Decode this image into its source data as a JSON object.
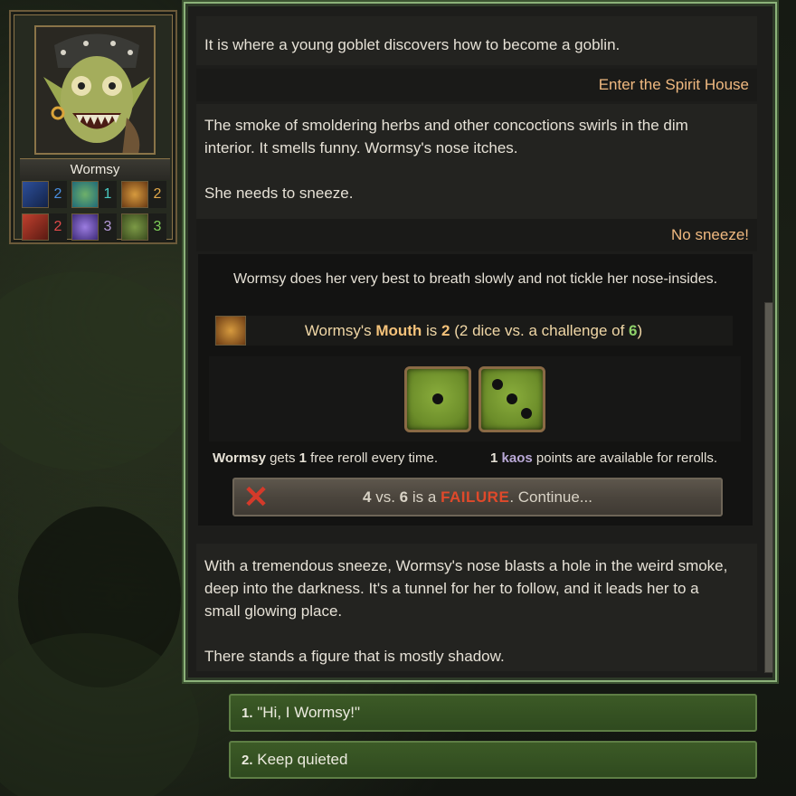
{
  "character": {
    "name": "Wormsy",
    "stats": [
      {
        "icon": "hood-goblin-icon",
        "value": "2",
        "color": "#4a8ee0"
      },
      {
        "icon": "goblin-face-icon",
        "value": "1",
        "color": "#48c9c2"
      },
      {
        "icon": "mouth-icon",
        "value": "2",
        "color": "#e0a84a"
      },
      {
        "icon": "muscle-goblin-icon",
        "value": "2",
        "color": "#e04a4a"
      },
      {
        "icon": "purple-creature-icon",
        "value": "3",
        "color": "#b59ad8"
      },
      {
        "icon": "leafy-goblin-icon",
        "value": "3",
        "color": "#7fcf5a"
      }
    ]
  },
  "story": {
    "intro": "It is where a young goblet discovers how to become a goblin.",
    "choice1": "Enter the Spirit House",
    "para1_line1": "The smoke of smoldering herbs and other concoctions swirls in the dim",
    "para1_line2": "interior. It smells funny. Wormsy's nose itches.",
    "para1_line3": "She needs to sneeze.",
    "choice2": "No sneeze!",
    "para2_line1": "With a tremendous sneeze, Wormsy's nose blasts a hole in the weird smoke,",
    "para2_line2": "deep into the darkness. It's a tunnel for her to follow, and it leads her to a",
    "para2_line3": "small glowing place.",
    "para2_line4": "There stands a figure that is mostly shadow."
  },
  "check": {
    "description": "Wormsy does her very best to breath slowly and not tickle her nose-insides.",
    "name_possessive": "Wormsy's",
    "stat_name": "Mouth",
    "is": "is",
    "stat_value": "2",
    "dice_pre": "(2 dice vs. a challenge of",
    "challenge": "6",
    "dice_post": ")",
    "dice": [
      1,
      3
    ],
    "reroll_name": "Wormsy",
    "reroll_gets": "gets",
    "reroll_count": "1",
    "reroll_rest": "free reroll every time.",
    "kaos_count": "1",
    "kaos_label": "kaos",
    "kaos_rest": "points are available for rerolls.",
    "result_total": "4",
    "result_vs": "vs.",
    "result_target": "6",
    "result_is_a": "is a",
    "result_word": "FAILURE",
    "result_continue": ". Continue..."
  },
  "options": [
    {
      "num": "1.",
      "label": "\"Hi, I Wormsy!\""
    },
    {
      "num": "2.",
      "label": "Keep quieted"
    }
  ],
  "colors": {
    "panel_border": "#8cb27a",
    "choice_echo": "#f0b980",
    "failure": "#e0492a",
    "option_bg": "#3c5a26"
  }
}
